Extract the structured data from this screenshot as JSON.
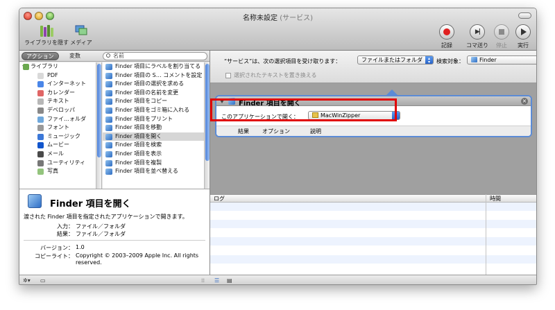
{
  "window": {
    "title": "名称未設定",
    "title_suffix": "(サービス)"
  },
  "toolbar": {
    "hide_library": "ライブラリを隠す",
    "media": "メディア",
    "record": "記録",
    "step": "コマ送り",
    "stop": "停止",
    "run": "実行"
  },
  "library_header": {
    "actions_tab": "アクション",
    "variables_tab": "変数",
    "search_placeholder": "名前"
  },
  "categories": [
    {
      "label": "ライブラリ",
      "color": "#6aa84f"
    },
    {
      "label": "PDF",
      "color": "#d9d9d9"
    },
    {
      "label": "インターネット",
      "color": "#4a86e8"
    },
    {
      "label": "カレンダー",
      "color": "#e06666"
    },
    {
      "label": "テキスト",
      "color": "#b7b7b7"
    },
    {
      "label": "デベロッパ",
      "color": "#888888"
    },
    {
      "label": "ファイ…ォルダ",
      "color": "#6fa8dc"
    },
    {
      "label": "フォント",
      "color": "#999999"
    },
    {
      "label": "ミュージック",
      "color": "#3c78d8"
    },
    {
      "label": "ムービー",
      "color": "#1155cc"
    },
    {
      "label": "メール",
      "color": "#4a4a4a"
    },
    {
      "label": "ユーティリティ",
      "color": "#777777"
    },
    {
      "label": "写真",
      "color": "#93c47d"
    }
  ],
  "actions": [
    "Finder 項目にラベルを割り当てる",
    "Finder 項目の S… コメントを設定",
    "Finder 項目の選択を求める",
    "Finder 項目の名前を変更",
    "Finder 項目をコピー",
    "Finder 項目をゴミ箱に入れる",
    "Finder 項目をプリント",
    "Finder 項目を移動",
    "Finder 項目を開く",
    "Finder 項目を検索",
    "Finder 項目を表示",
    "Finder 項目を複製",
    "Finder 項目を並べ替える"
  ],
  "selected_action_index": 8,
  "description": {
    "title": "Finder 項目を開く",
    "text": "渡された Finder 項目を指定されたアプリケーションで開きます。",
    "input_label": "入力：",
    "input_value": "ファイル／フォルダ",
    "result_label": "結果：",
    "result_value": "ファイル／フォルダ",
    "version_label": "バージョン：",
    "version_value": "1.0",
    "copyright_label": "コピーライト：",
    "copyright_value_1": "Copyright © 2003–2009 Apple Inc.  All rights",
    "copyright_value_2": "reserved."
  },
  "service_bar": {
    "receives_label": "“サービス”は、次の選択項目を受け取ります：",
    "receives_value": "ファイルまたはフォルダ",
    "target_label": "検索対象：",
    "target_value": "Finder",
    "replace_text_label": "選択されたテキストを置き換える"
  },
  "action_box": {
    "title": "Finder 項目を開く",
    "open_with_label": "このアプリケーションで開く：",
    "open_with_value": "MacWinZipper",
    "tab_results": "結果",
    "tab_options": "オプション",
    "tab_description": "説明"
  },
  "log": {
    "col_log": "ログ",
    "col_time": "時間"
  },
  "colors": {
    "highlight_red": "#e10000",
    "selection_blue": "#5b8bd6"
  }
}
